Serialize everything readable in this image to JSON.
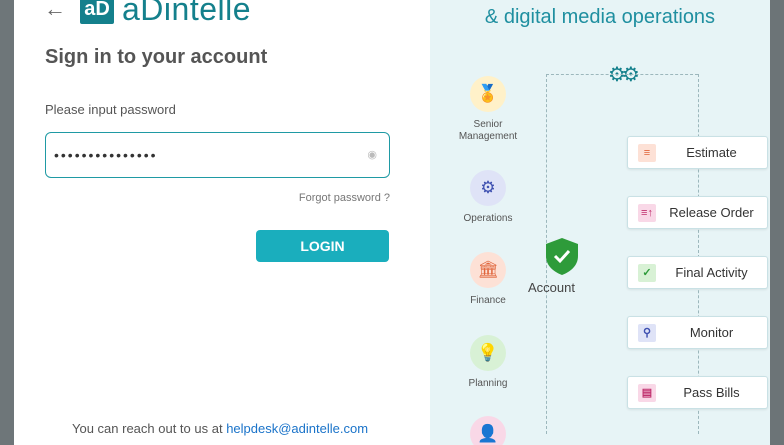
{
  "login": {
    "back_icon": "back-arrow-icon",
    "logo_mark": "aD",
    "logo_text": "aDintelle",
    "title": "Sign in to your account",
    "password_label": "Please input password",
    "password_value": "•••••••••••••••",
    "forgot_label": "Forgot password ?",
    "login_label": "LOGIN",
    "footer_text": "You can reach out to us at ",
    "footer_email": "helpdesk@adintelle.com"
  },
  "art": {
    "title_line1": "& digital media operations",
    "departments": [
      {
        "name": "Senior\nManagement",
        "icon": "medal-icon",
        "color": "#f5a623",
        "bg": "#fff1c9"
      },
      {
        "name": "Operations",
        "icon": "gear-icon",
        "color": "#3d4fb0",
        "bg": "#dfe3f7"
      },
      {
        "name": "Finance",
        "icon": "bank-icon",
        "color": "#e0643a",
        "bg": "#fde1d6"
      },
      {
        "name": "Planning",
        "icon": "lightbulb-icon",
        "color": "#2e9b3a",
        "bg": "#d8f1d5"
      },
      {
        "name": "",
        "icon": "user-icon",
        "color": "#c0306e",
        "bg": "#f9d8e7"
      }
    ],
    "account_label": "Account",
    "steps": [
      {
        "label": "Estimate",
        "icon": "document-icon",
        "color": "#e0643a",
        "bg": "#fde1d6"
      },
      {
        "label": "Release Order",
        "icon": "release-order-icon",
        "color": "#c0306e",
        "bg": "#f9d8e7"
      },
      {
        "label": "Final Activity",
        "icon": "check-circle-icon",
        "color": "#2e9b3a",
        "bg": "#d8f1d5"
      },
      {
        "label": "Monitor",
        "icon": "magnifier-icon",
        "color": "#3d4fb0",
        "bg": "#dfe3f7"
      },
      {
        "label": "Pass Bills",
        "icon": "bill-icon",
        "color": "#c0306e",
        "bg": "#f9d8e7"
      }
    ]
  }
}
